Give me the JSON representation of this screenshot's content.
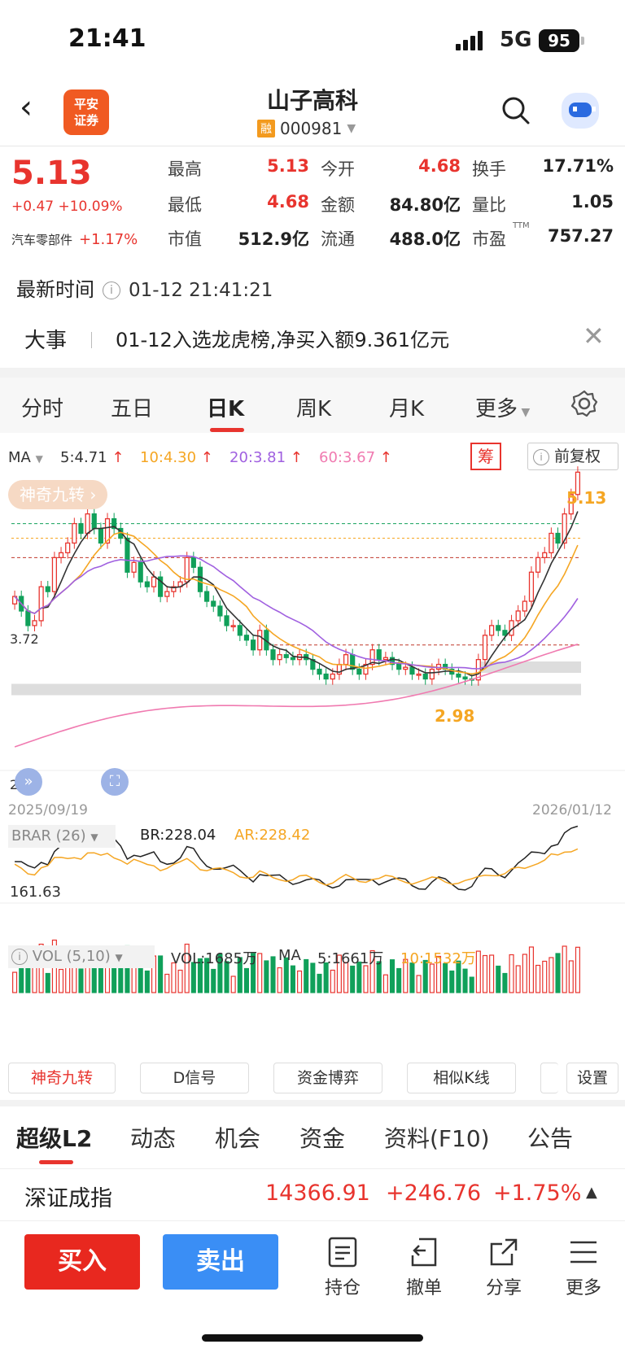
{
  "status": {
    "time": "21:41",
    "network": "5G",
    "battery": "95"
  },
  "header": {
    "logo_line1": "平安",
    "logo_line2": "证券",
    "title": "山子高科",
    "badge": "融",
    "code": "000981"
  },
  "quote": {
    "price": "5.13",
    "change": "+0.47 +10.09%",
    "sector": "汽车零部件",
    "sector_change": "+1.17%",
    "rows": [
      [
        {
          "l": "最高",
          "v": "5.13"
        },
        {
          "l": "今开",
          "v": "4.68"
        },
        {
          "l": "换手",
          "v": "17.71%"
        }
      ],
      [
        {
          "l": "最低",
          "v": "4.68"
        },
        {
          "l": "金额",
          "v": "84.80亿"
        },
        {
          "l": "量比",
          "v": "1.05"
        }
      ],
      [
        {
          "l": "市值",
          "v": "512.9亿"
        },
        {
          "l": "流通",
          "v": "488.0亿"
        },
        {
          "l": "市盈",
          "v": "757.27"
        }
      ]
    ],
    "ttm": "TTM"
  },
  "latest": {
    "label": "最新时间",
    "value": "01-12 21:41:21"
  },
  "event": {
    "label": "大事",
    "text": "01-12入选龙虎榜,净买入额9.361亿元"
  },
  "tabs": [
    "分时",
    "五日",
    "日K",
    "周K",
    "月K",
    "更多"
  ],
  "chart_legend": {
    "ma": "MA",
    "ma5": "5:4.71",
    "ma10": "10:4.30",
    "ma20": "20:3.81",
    "ma60": "60:3.67",
    "chip": "筹",
    "adjust": "前复权",
    "nine": "神奇九转",
    "date_start": "2025/09/19",
    "date_end": "2026/01/12",
    "high_label": "5.13",
    "low_label": "2.98",
    "left_mid": "3.72",
    "left_bottom": "2.28"
  },
  "brar": {
    "name": "BRAR (26)",
    "br": "BR:228.04",
    "ar": "AR:228.42",
    "axis": "161.63"
  },
  "vol": {
    "name": "VOL (5,10)",
    "vol": "VOL:1685万",
    "ma": "MA",
    "ma5": "5:1661万",
    "ma10": "10:1532万"
  },
  "tool_buttons": [
    "神奇九转",
    "D信号",
    "资金博弈",
    "相似K线",
    "设置"
  ],
  "bottom_tabs": [
    "超级L2",
    "动态",
    "机会",
    "资金",
    "资料(F10)",
    "公告"
  ],
  "index": {
    "name": "深证成指",
    "value": "14366.91",
    "change": "+246.76",
    "pct": "+1.75%"
  },
  "actions": {
    "buy": "买入",
    "sell": "卖出",
    "items": [
      "持仓",
      "撤单",
      "分享",
      "更多"
    ]
  },
  "colors": {
    "up": "#e8342e",
    "down": "#10a05a",
    "ma5": "#333333",
    "ma10": "#f5a623",
    "ma20": "#a060e0",
    "ma60": "#f07ab0"
  },
  "chart_data": {
    "type": "candlestick",
    "x_range": [
      "2025/09/19",
      "2026/01/12"
    ],
    "close": [
      3.85,
      3.7,
      3.55,
      3.6,
      3.95,
      3.9,
      4.25,
      4.3,
      4.4,
      4.6,
      4.5,
      4.7,
      4.55,
      4.4,
      4.65,
      4.55,
      4.45,
      4.1,
      4.2,
      4.0,
      3.95,
      4.05,
      3.85,
      3.9,
      3.95,
      4.0,
      4.25,
      4.15,
      3.9,
      3.8,
      3.75,
      3.65,
      3.55,
      3.55,
      3.45,
      3.4,
      3.3,
      3.5,
      3.3,
      3.2,
      3.25,
      3.22,
      3.2,
      3.25,
      3.2,
      3.1,
      3.05,
      3.0,
      3.05,
      3.15,
      3.25,
      3.1,
      3.05,
      3.15,
      3.3,
      3.2,
      3.22,
      3.15,
      3.1,
      3.12,
      3.05,
      3.05,
      3.0,
      3.1,
      3.15,
      3.1,
      3.05,
      3.02,
      3.0,
      2.99,
      3.2,
      3.45,
      3.55,
      3.5,
      3.45,
      3.6,
      3.7,
      3.8,
      4.1,
      4.25,
      4.3,
      4.5,
      4.4,
      4.7,
      4.9,
      5.13
    ]
  }
}
